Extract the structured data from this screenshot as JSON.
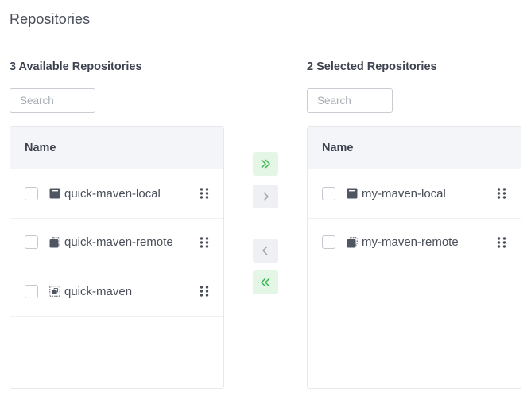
{
  "section": {
    "title": "Repositories"
  },
  "available": {
    "title": "3 Available Repositories",
    "search_placeholder": "Search",
    "column_header": "Name",
    "items": [
      {
        "name": "quick-maven-local",
        "type": "local-repo-icon"
      },
      {
        "name": "quick-maven-remote",
        "type": "remote-repo-icon"
      },
      {
        "name": "quick-maven",
        "type": "virtual-repo-icon"
      }
    ]
  },
  "selected": {
    "title": "2 Selected Repositories",
    "search_placeholder": "Search",
    "column_header": "Name",
    "items": [
      {
        "name": "my-maven-local",
        "type": "local-repo-icon"
      },
      {
        "name": "my-maven-remote",
        "type": "remote-repo-icon"
      }
    ]
  },
  "transfer": {
    "buttons": [
      {
        "action": "move-all-right",
        "icon": "double-chevron-right-icon",
        "color": "#35b24a"
      },
      {
        "action": "move-right",
        "icon": "chevron-right-icon",
        "color": "#9aa0ab"
      },
      {
        "action": "move-left",
        "icon": "chevron-left-icon",
        "color": "#9aa0ab"
      },
      {
        "action": "move-all-left",
        "icon": "double-chevron-left-icon",
        "color": "#35b24a"
      }
    ]
  },
  "colors": {
    "accent_green": "#35b24a",
    "text": "#3a3f4b",
    "panel_header": "#f4f5f8"
  }
}
